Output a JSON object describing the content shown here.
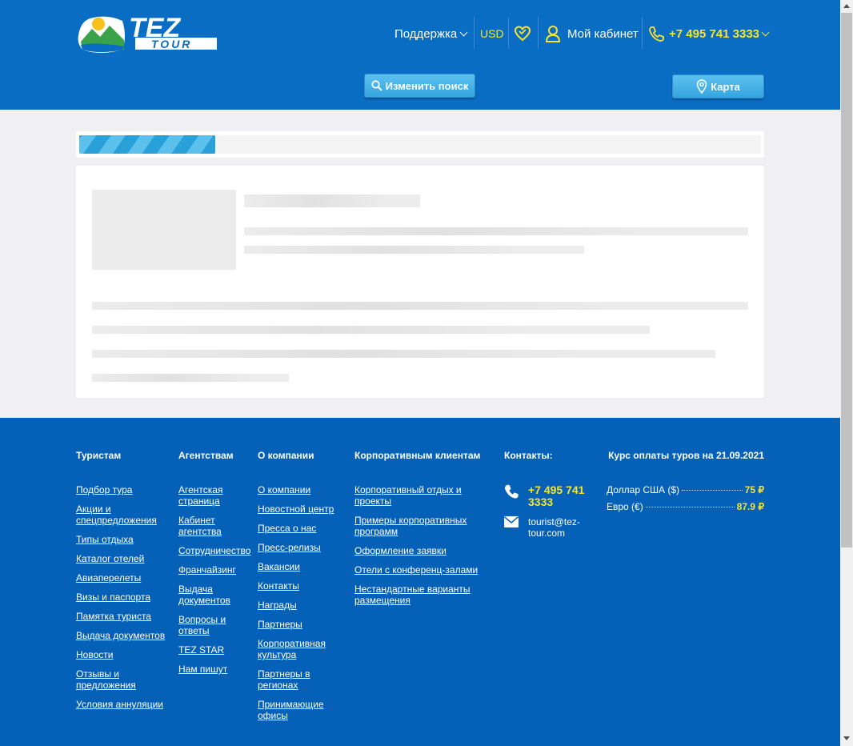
{
  "header": {
    "logo_text_top": "TEZ",
    "logo_text_bottom": "TOUR",
    "support_label": "Поддержка",
    "currency_label": "USD",
    "cabinet_label": "Мой кабинет",
    "phone_label": "+7 495 741 3333",
    "change_search_label": "Изменить поиск",
    "map_label": "Карта"
  },
  "loading": {
    "progress_percent": 20
  },
  "footer": {
    "tourists": {
      "title": "Туристам",
      "links": [
        "Подбор тура",
        "Акции и спецпредложения",
        "Типы отдыха",
        "Каталог отелей",
        "Авиаперелеты",
        "Визы и паспорта",
        "Памятка туриста",
        "Выдача документов",
        "Новости",
        "Отзывы и предложения",
        "Условия аннуляции"
      ]
    },
    "agents": {
      "title": "Агентствам",
      "links": [
        "Агентская страница",
        "Кабинет агентства",
        "Сотрудничество",
        "Франчайзинг",
        "Выдача документов",
        "Вопросы и ответы",
        "TEZ STAR",
        "Нам пишут"
      ]
    },
    "company": {
      "title": "О компании",
      "links": [
        "О компании",
        "Новостной центр",
        "Пресса о нас",
        "Пресс-релизы",
        "Вакансии",
        "Контакты",
        "Награды",
        "Партнеры",
        "Корпоративная культура",
        "Партнеры в регионах",
        "Принимающие офисы"
      ]
    },
    "corporate": {
      "title": "Корпоративным клиентам",
      "links": [
        "Корпоративный отдых и проекты",
        "Примеры корпоративных программ",
        "Оформление заявки",
        "Отели с конференц-залами",
        "Нестандартные варианты размещения"
      ]
    },
    "contacts": {
      "title": "Контакты:",
      "phone": "+7 495 741 3333",
      "email": "tourist@tez-tour.com"
    },
    "rates": {
      "title": "Курс оплаты туров на 21.09.2021",
      "items": [
        {
          "label": "Доллар США ($)",
          "value": "75 ₽"
        },
        {
          "label": "Евро (€)",
          "value": "87.9 ₽"
        }
      ]
    }
  },
  "colors": {
    "header_bg": "#0a6dc4",
    "footer_bg": "#0561b8",
    "accent_yellow": "#f7e431",
    "button_blue": "#3fb0e6"
  },
  "icons": {
    "support": "chevron-down-icon",
    "favorites": "heart-icon",
    "cabinet": "user-icon",
    "phone": "phone-icon",
    "search": "search-icon",
    "map": "map-pin-icon",
    "email": "envelope-icon"
  }
}
